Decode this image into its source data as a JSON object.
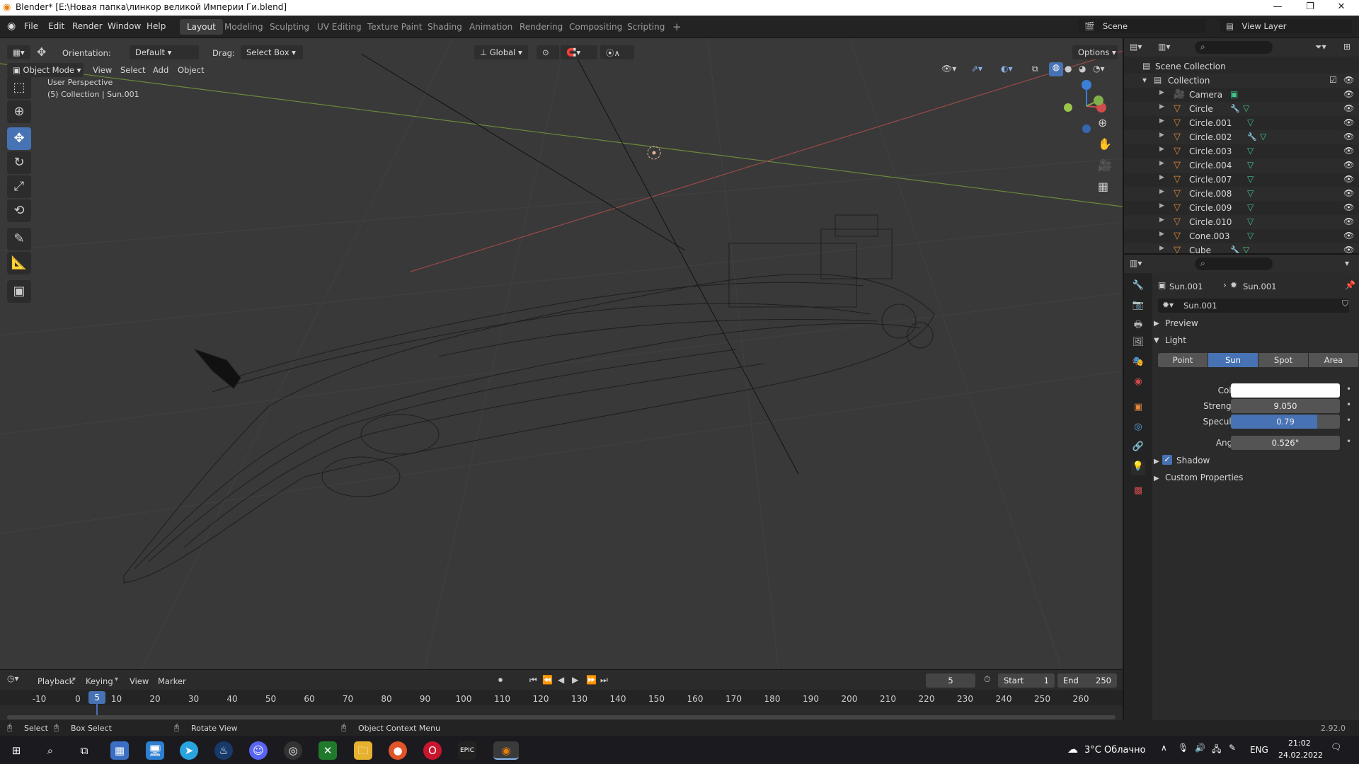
{
  "window": {
    "title": "Blender* [E:\\Новая папка\\линкор великой Империи Ги.blend]"
  },
  "menu": [
    "File",
    "Edit",
    "Render",
    "Window",
    "Help"
  ],
  "workspaces": [
    "Layout",
    "Modeling",
    "Sculpting",
    "UV Editing",
    "Texture Paint",
    "Shading",
    "Animation",
    "Rendering",
    "Compositing",
    "Scripting"
  ],
  "active_workspace": "Layout",
  "scene": {
    "name": "Scene",
    "view_layer": "View Layer"
  },
  "tool_header": {
    "orientation_label": "Orientation:",
    "orientation_value": "Default",
    "drag_label": "Drag:",
    "drag_value": "Select Box",
    "transform": "Global",
    "options": "Options"
  },
  "viewport_header": {
    "mode": "Object Mode",
    "menus": [
      "View",
      "Select",
      "Add",
      "Object"
    ]
  },
  "viewport": {
    "perspective": "User Perspective",
    "info": "(5) Collection | Sun.001"
  },
  "outliner": {
    "root": "Scene Collection",
    "collection": "Collection",
    "items": [
      {
        "name": "Camera",
        "type": "camera",
        "modifier": false
      },
      {
        "name": "Circle",
        "type": "mesh",
        "modifier": true
      },
      {
        "name": "Circle.001",
        "type": "mesh",
        "modifier": false
      },
      {
        "name": "Circle.002",
        "type": "mesh",
        "modifier": true
      },
      {
        "name": "Circle.003",
        "type": "mesh",
        "modifier": false
      },
      {
        "name": "Circle.004",
        "type": "mesh",
        "modifier": false
      },
      {
        "name": "Circle.007",
        "type": "mesh",
        "modifier": false
      },
      {
        "name": "Circle.008",
        "type": "mesh",
        "modifier": false
      },
      {
        "name": "Circle.009",
        "type": "mesh",
        "modifier": false
      },
      {
        "name": "Circle.010",
        "type": "mesh",
        "modifier": false
      },
      {
        "name": "Cone.003",
        "type": "mesh",
        "modifier": false
      },
      {
        "name": "Cube",
        "type": "mesh",
        "modifier": true
      }
    ]
  },
  "properties": {
    "object_name": "Sun.001",
    "data_name": "Sun.001",
    "datablock": "Sun.001",
    "preview_label": "Preview",
    "light_label": "Light",
    "light_types": [
      "Point",
      "Sun",
      "Spot",
      "Area"
    ],
    "active_type": "Sun",
    "color_label": "Color",
    "color_value": "#ffffff",
    "strength_label": "Strength",
    "strength": "9.050",
    "specular_label": "Specular",
    "specular": "0.79",
    "specular_fraction": 0.79,
    "angle_label": "Angle",
    "angle": "0.526°",
    "shadow_label": "Shadow",
    "shadow_checked": true,
    "custom_label": "Custom Properties"
  },
  "timeline": {
    "menus": [
      "Playback",
      "Keying",
      "View",
      "Marker"
    ],
    "current_frame": "5",
    "start_label": "Start",
    "start": "1",
    "end_label": "End",
    "end": "250",
    "ticks": [
      "-10",
      "0",
      "10",
      "20",
      "30",
      "40",
      "50",
      "60",
      "70",
      "80",
      "90",
      "100",
      "110",
      "120",
      "130",
      "140",
      "150",
      "160",
      "170",
      "180",
      "190",
      "200",
      "210",
      "220",
      "230",
      "240",
      "250",
      "260"
    ]
  },
  "status": {
    "select": "Select",
    "box_select": "Box Select",
    "rotate": "Rotate View",
    "context": "Object Context Menu",
    "version": "2.92.0"
  },
  "taskbar": {
    "weather": "3°C Облачно",
    "lang": "ENG",
    "time": "21:02",
    "date": "24.02.2022"
  },
  "colors": {
    "accent": "#4772b3",
    "mesh_icon": "#e08a3c",
    "modifier_icon": "#5aa7e8",
    "data_icon": "#43c38a"
  }
}
